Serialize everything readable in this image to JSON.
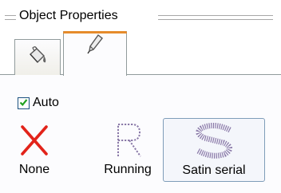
{
  "header": {
    "title": "Object Properties"
  },
  "tabs": [
    {
      "icon": "fill-bucket-icon"
    },
    {
      "icon": "pen-icon",
      "selected": true
    }
  ],
  "auto": {
    "label": "Auto",
    "checked": true
  },
  "stitch_styles": [
    {
      "label": "None",
      "icon": "red-x-icon"
    },
    {
      "label": "Running",
      "icon": "dotted-r-icon"
    },
    {
      "label": "Satin serial",
      "icon": "satin-s-icon",
      "selected": true
    }
  ],
  "colors": {
    "accent": "#e68b2c",
    "check": "#21a121",
    "none_x": "#e2231a",
    "stitch": "#8a79a8"
  }
}
